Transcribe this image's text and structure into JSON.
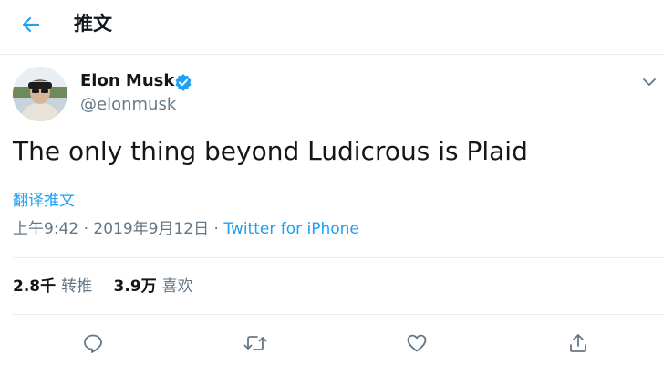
{
  "header": {
    "title": "推文",
    "back_icon": "arrow-left-icon",
    "accent": "#1da1f2"
  },
  "tweet": {
    "author_name": "Elon Musk",
    "author_handle": "@elonmusk",
    "verified_icon": "verified-badge-icon",
    "menu_icon": "chevron-down-icon",
    "text": "The only thing beyond Ludicrous is Plaid",
    "translate_label": "翻译推文",
    "time": "上午9:42",
    "separator": "·",
    "date": "2019年9月12日",
    "source": "Twitter for iPhone"
  },
  "stats": {
    "retweets_count": "2.8千",
    "retweets_label": "转推",
    "likes_count": "3.9万",
    "likes_label": "喜欢"
  },
  "actions": {
    "reply_icon": "reply-icon",
    "retweet_icon": "retweet-icon",
    "like_icon": "heart-icon",
    "share_icon": "share-icon"
  },
  "colors": {
    "text": "#14171a",
    "secondary": "#657786",
    "link": "#1da1f2",
    "divider": "#e6ecf0"
  }
}
